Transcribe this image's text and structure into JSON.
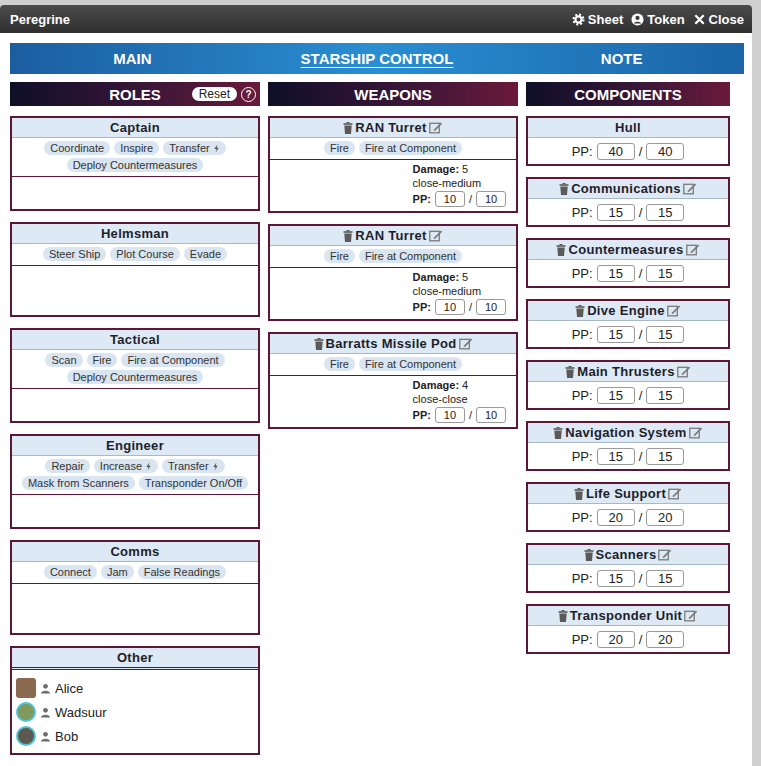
{
  "window": {
    "title": "Peregrine",
    "buttons": [
      {
        "label": "Sheet",
        "kind": "sheet"
      },
      {
        "label": "Token",
        "kind": "token"
      },
      {
        "label": "Close",
        "kind": "close"
      }
    ]
  },
  "tabs": [
    {
      "label": "MAIN",
      "selected": false
    },
    {
      "label": "STARSHIP CONTROL",
      "selected": true
    },
    {
      "label": "NOTE",
      "selected": false
    }
  ],
  "roles": {
    "title": "ROLES",
    "reset": "Reset",
    "help": "?",
    "items": [
      {
        "name": "Captain",
        "actions": [
          {
            "label": "Coordinate",
            "boost": false
          },
          {
            "label": "Inspire",
            "boost": false
          },
          {
            "label": "Transfer",
            "boost": true
          },
          {
            "label": "Deploy Countermeasures",
            "boost": false
          }
        ]
      },
      {
        "name": "Helmsman",
        "actions": [
          {
            "label": "Steer Ship",
            "boost": false
          },
          {
            "label": "Plot Course",
            "boost": false
          },
          {
            "label": "Evade",
            "boost": false
          }
        ]
      },
      {
        "name": "Tactical",
        "actions": [
          {
            "label": "Scan",
            "boost": false
          },
          {
            "label": "Fire",
            "boost": false
          },
          {
            "label": "Fire at Component",
            "boost": false
          },
          {
            "label": "Deploy Countermeasures",
            "boost": false
          }
        ]
      },
      {
        "name": "Engineer",
        "actions": [
          {
            "label": "Repair",
            "boost": false
          },
          {
            "label": "Increase",
            "boost": true
          },
          {
            "label": "Transfer",
            "boost": true
          },
          {
            "label": "Mask from Scanners",
            "boost": false
          },
          {
            "label": "Transponder On/Off",
            "boost": false
          }
        ]
      },
      {
        "name": "Comms",
        "actions": [
          {
            "label": "Connect",
            "boost": false
          },
          {
            "label": "Jam",
            "boost": false
          },
          {
            "label": "False Readings",
            "boost": false
          }
        ]
      }
    ],
    "other": {
      "name": "Other",
      "crew": [
        {
          "name": "Alice",
          "color": "#8a6a4e",
          "ringed": false
        },
        {
          "name": "Wadsuur",
          "color": "#7f9a5c",
          "ringed": true
        },
        {
          "name": "Bob",
          "color": "#5c5a50",
          "ringed": true
        }
      ]
    }
  },
  "weapons": {
    "title": "WEAPONS",
    "damage_label": "Damage:",
    "pp_label": "PP:",
    "separator": "/",
    "items": [
      {
        "name": "RAN Turret",
        "actions": [
          "Fire",
          "Fire at Component"
        ],
        "damage": "5",
        "range": "close-medium",
        "pp": "10",
        "pp_max": "10"
      },
      {
        "name": "RAN Turret",
        "actions": [
          "Fire",
          "Fire at Component"
        ],
        "damage": "5",
        "range": "close-medium",
        "pp": "10",
        "pp_max": "10"
      },
      {
        "name": "Barratts Missile Pod",
        "actions": [
          "Fire",
          "Fire at Component"
        ],
        "damage": "4",
        "range": "close-close",
        "pp": "10",
        "pp_max": "10"
      }
    ]
  },
  "components": {
    "title": "COMPONENTS",
    "pp_label": "PP:",
    "separator": "/",
    "items": [
      {
        "name": "Hull",
        "removable": false,
        "pp": "40",
        "pp_max": "40"
      },
      {
        "name": "Communications",
        "removable": true,
        "pp": "15",
        "pp_max": "15"
      },
      {
        "name": "Countermeasures",
        "removable": true,
        "pp": "15",
        "pp_max": "15"
      },
      {
        "name": "Dive Engine",
        "removable": true,
        "pp": "15",
        "pp_max": "15"
      },
      {
        "name": "Main Thrusters",
        "removable": true,
        "pp": "15",
        "pp_max": "15"
      },
      {
        "name": "Navigation System",
        "removable": true,
        "pp": "15",
        "pp_max": "15"
      },
      {
        "name": "Life Support",
        "removable": true,
        "pp": "20",
        "pp_max": "20"
      },
      {
        "name": "Scanners",
        "removable": true,
        "pp": "15",
        "pp_max": "15"
      },
      {
        "name": "Transponder Unit",
        "removable": true,
        "pp": "20",
        "pp_max": "20"
      }
    ]
  }
}
